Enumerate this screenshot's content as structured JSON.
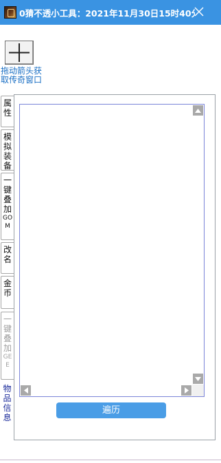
{
  "window": {
    "title": "0猜不透小工具：2021年11月30日15时40分1..."
  },
  "crosshair": {
    "label": "拖动箭头获取传奇窗口"
  },
  "tabs": [
    {
      "label": "属性",
      "suffix": "",
      "state": "normal"
    },
    {
      "label": "模拟装备",
      "suffix": "",
      "state": "normal"
    },
    {
      "label": "一键叠加",
      "suffix": "GOM",
      "state": "normal"
    },
    {
      "label": "改名",
      "suffix": "",
      "state": "normal"
    },
    {
      "label": "金币",
      "suffix": "",
      "state": "normal"
    },
    {
      "label": "一键叠加",
      "suffix": "GEE",
      "state": "disabled"
    },
    {
      "label": "物品信息",
      "suffix": "",
      "state": "active"
    }
  ],
  "actions": {
    "traverse_label": "遍历"
  },
  "colors": {
    "titlebar": "#3a93e2",
    "accent_button": "#4a9de6",
    "link_text": "#1a6fc4",
    "active_tab_text": "#1a2a9a"
  }
}
